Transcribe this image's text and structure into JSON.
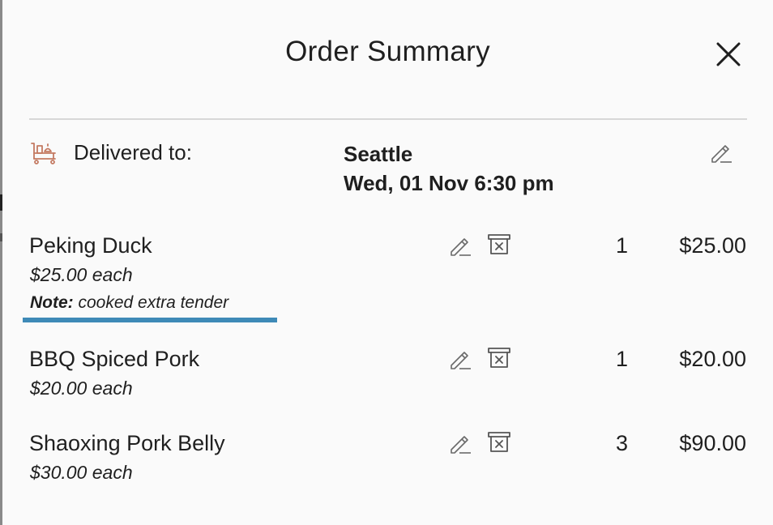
{
  "title": "Order Summary",
  "delivery": {
    "label": "Delivered to:",
    "location": "Seattle",
    "datetime": "Wed, 01 Nov 6:30 pm"
  },
  "icons": {
    "close": "close-icon",
    "delivery": "delivery-cart-icon",
    "edit": "pencil-icon",
    "delete": "trash-icon"
  },
  "colors": {
    "accent_icon": "#c47a62",
    "note_underline": "#3e8ab7",
    "text": "#1f1f1f"
  },
  "items": [
    {
      "name": "Peking Duck",
      "price_each": "$25.00 each",
      "note_label": "Note:",
      "note_text": " cooked extra tender",
      "quantity": "1",
      "total": "$25.00"
    },
    {
      "name": "BBQ Spiced Pork",
      "price_each": "$20.00 each",
      "quantity": "1",
      "total": "$20.00"
    },
    {
      "name": "Shaoxing Pork Belly",
      "price_each": "$30.00 each",
      "quantity": "3",
      "total": "$90.00"
    }
  ]
}
